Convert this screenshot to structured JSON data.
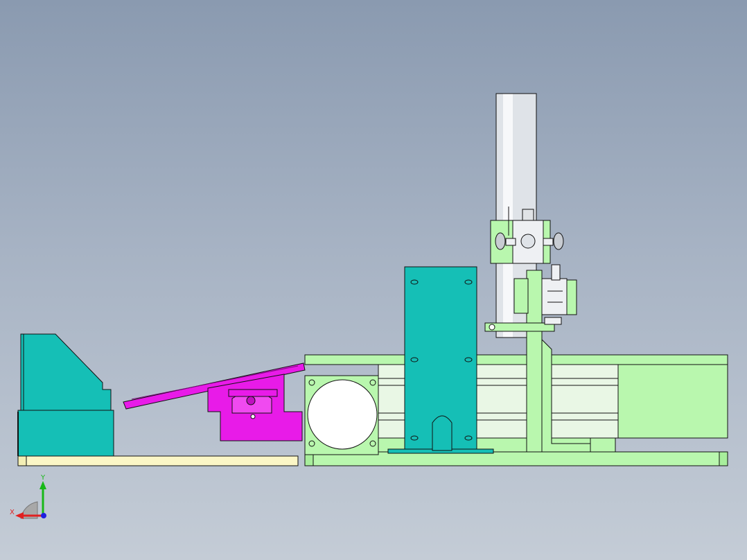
{
  "viewport": {
    "background_top": "#8a9ab0",
    "background_bottom": "#c4ccd6"
  },
  "colors": {
    "teal_part": "#15bfb6",
    "magenta_part": "#e81be8",
    "light_green_part": "#b9f7ae",
    "cream_base": "#fbf6c6",
    "silver_cylinder": "#dfe3e8",
    "outline": "#111111"
  },
  "triad": {
    "x_label": "X",
    "y_label": "Y",
    "x_color": "#e02020",
    "y_color": "#18b818",
    "z_color": "#2020e0"
  }
}
